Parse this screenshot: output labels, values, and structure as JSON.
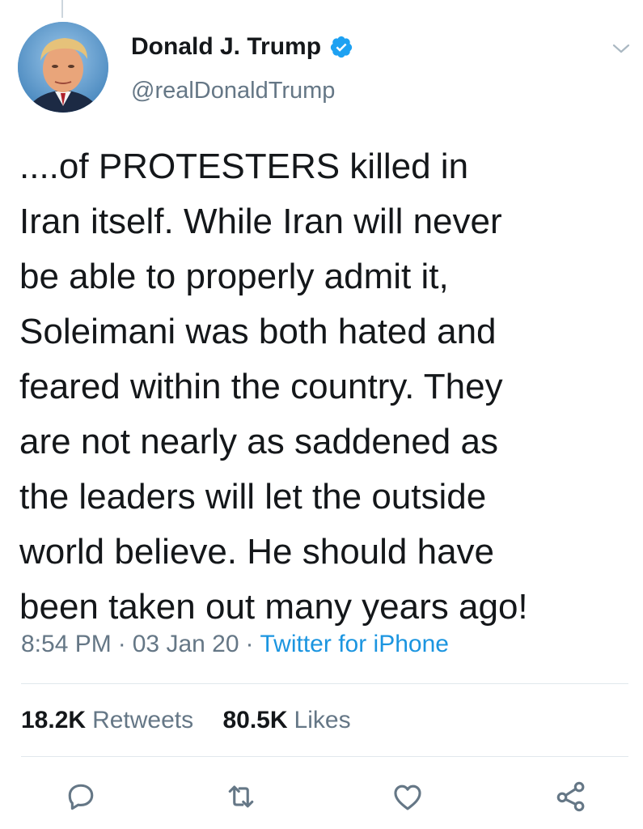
{
  "author": {
    "display_name": "Donald J. Trump",
    "handle": "@realDonaldTrump",
    "verified": true
  },
  "tweet": {
    "text_lines": [
      "....of PROTESTERS killed in",
      "Iran itself. While Iran will never",
      "be able to properly admit it,",
      "Soleimani was both hated and",
      "feared within the country. They",
      "are not nearly as saddened as",
      "the leaders will let the outside",
      "world believe. He should have",
      "been taken out many years ago!"
    ],
    "time": "8:54 PM",
    "date": "03 Jan 20",
    "separator": "·",
    "source": "Twitter for iPhone"
  },
  "stats": {
    "retweets_count": "18.2K",
    "retweets_label": "Retweets",
    "likes_count": "80.5K",
    "likes_label": "Likes"
  },
  "icons": {
    "verified": "verified-badge-icon",
    "caret": "chevron-down-icon",
    "reply": "reply-icon",
    "retweet": "retweet-icon",
    "like": "heart-icon",
    "share": "share-icon"
  },
  "colors": {
    "text": "#14171a",
    "secondary": "#657786",
    "accent": "#1b95e0",
    "divider": "#e1e8ed"
  }
}
